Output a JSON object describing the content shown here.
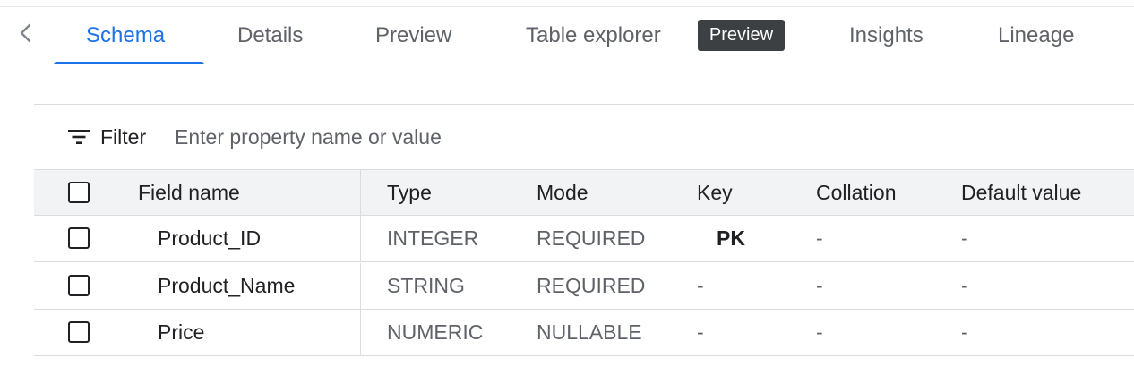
{
  "tabs": [
    {
      "label": "Schema",
      "active": true
    },
    {
      "label": "Details",
      "active": false
    },
    {
      "label": "Preview",
      "active": false
    },
    {
      "label": "Table explorer",
      "active": false,
      "badge": "Preview"
    },
    {
      "label": "Insights",
      "active": false
    },
    {
      "label": "Lineage",
      "active": false
    }
  ],
  "filter": {
    "label": "Filter",
    "placeholder": "Enter property name or value"
  },
  "table": {
    "headers": [
      "Field name",
      "Type",
      "Mode",
      "Key",
      "Collation",
      "Default value"
    ],
    "rows": [
      {
        "field": "Product_ID",
        "type": "INTEGER",
        "mode": "REQUIRED",
        "key": "PK",
        "collation": "-",
        "default": "-"
      },
      {
        "field": "Product_Name",
        "type": "STRING",
        "mode": "REQUIRED",
        "key": "-",
        "collation": "-",
        "default": "-"
      },
      {
        "field": "Price",
        "type": "NUMERIC",
        "mode": "NULLABLE",
        "key": "-",
        "collation": "-",
        "default": "-"
      }
    ]
  },
  "colors": {
    "accent": "#1a73e8",
    "badge_bg": "#3c4043",
    "header_bg": "#f1f3f4",
    "border": "#dadce0"
  },
  "icons": {
    "back": "chevron-left-icon",
    "filter": "filter-icon"
  }
}
